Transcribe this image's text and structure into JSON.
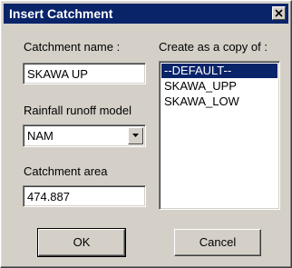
{
  "dialog": {
    "title": "Insert Catchment",
    "close_label": "close"
  },
  "form": {
    "catchment_name_label": "Catchment name :",
    "catchment_name_value": "SKAWA UP",
    "runoff_model_label": "Rainfall runoff model",
    "runoff_model_value": "NAM",
    "catchment_area_label": "Catchment area",
    "catchment_area_value": "474.887"
  },
  "copy_list": {
    "label": "Create as a copy of :",
    "items": [
      "--DEFAULT--",
      "SKAWA_UPP",
      "SKAWA_LOW"
    ],
    "selected": "--DEFAULT--"
  },
  "buttons": {
    "ok_label": "OK",
    "cancel_label": "Cancel"
  },
  "colors": {
    "titlebar": "#0a246a",
    "face": "#d4d0c8",
    "selection": "#0a246a"
  },
  "icons": {
    "close": "close-icon",
    "dropdown": "chevron-down-icon"
  }
}
